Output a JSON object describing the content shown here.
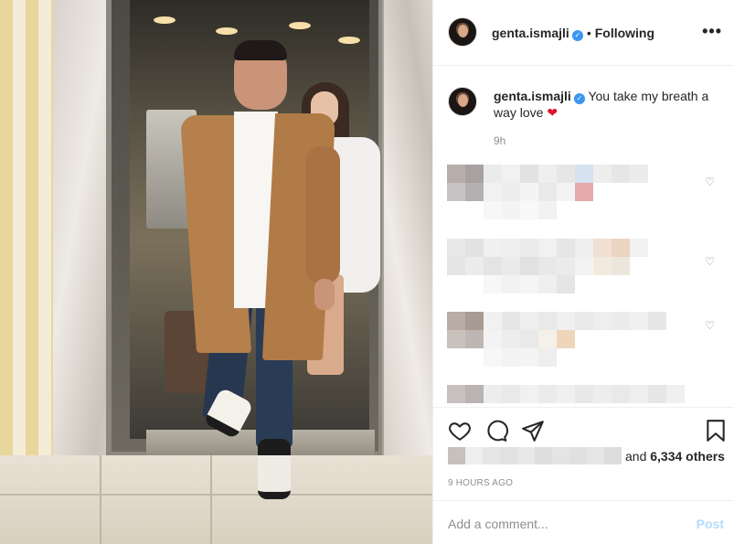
{
  "post": {
    "username": "genta.ismajli",
    "follow_state": "Following",
    "separator": "•",
    "more_glyph": "•••",
    "caption": "You take my breath a way love",
    "caption_emoji": "❤",
    "caption_time": "9h",
    "likes_suffix_prefix": "and ",
    "likes_count": "6,334 others",
    "time_ago": "9 HOURS AGO",
    "comment_placeholder": "Add a comment...",
    "post_label": "Post"
  },
  "colors": {
    "verified": "#3897f0",
    "heart_red": "#e0142d",
    "muted_text": "#8e8e8e",
    "post_disabled": "#b3dbff"
  },
  "icons": {
    "heart": "heart-icon",
    "comment": "comment-icon",
    "share": "share-icon",
    "save": "bookmark-icon",
    "more": "more-icon",
    "verified": "verified-badge-icon"
  }
}
